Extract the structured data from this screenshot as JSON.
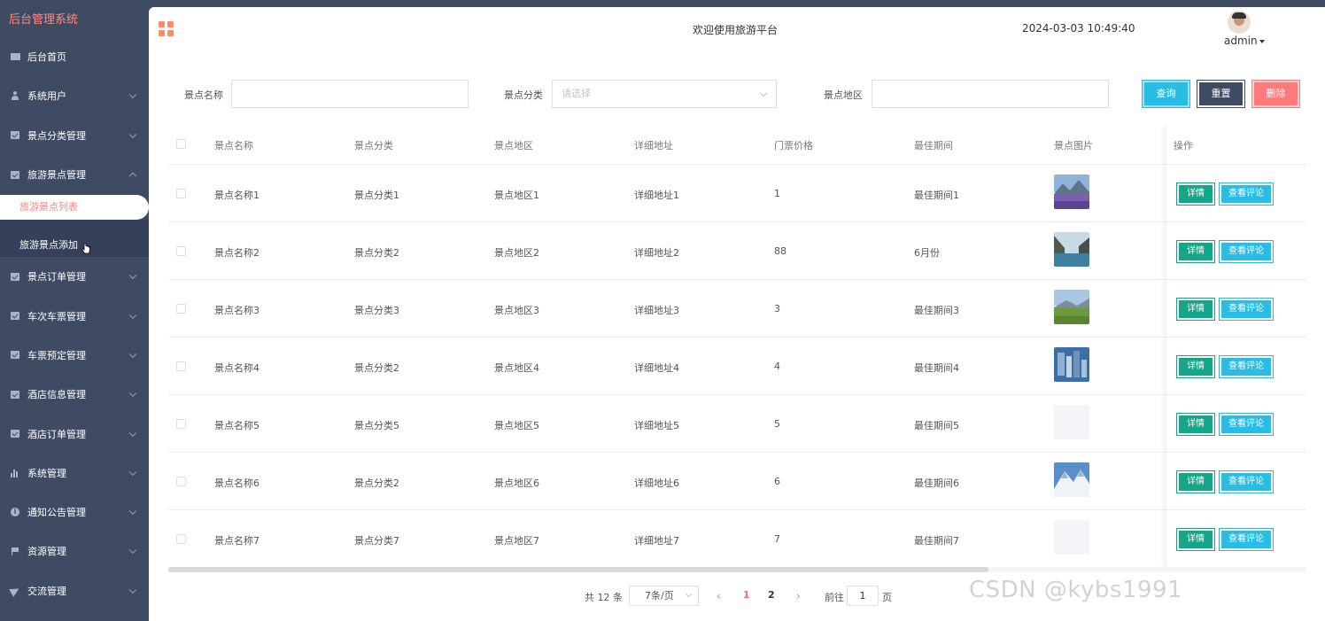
{
  "brand": "后台管理系统",
  "sidebar": {
    "items": [
      {
        "label": "后台首页",
        "icon": "monitor-icon",
        "chevron": false
      },
      {
        "label": "系统用户",
        "icon": "user-icon",
        "chevron": true
      },
      {
        "label": "景点分类管理",
        "icon": "checkbox-icon",
        "chevron": true
      },
      {
        "label": "旅游景点管理",
        "icon": "checkbox-icon",
        "chevron": true,
        "expanded": true
      },
      {
        "label": "景点订单管理",
        "icon": "checkbox-icon",
        "chevron": true
      },
      {
        "label": "车次车票管理",
        "icon": "checkbox-icon",
        "chevron": true
      },
      {
        "label": "车票预定管理",
        "icon": "checkbox-icon",
        "chevron": true
      },
      {
        "label": "酒店信息管理",
        "icon": "checkbox-icon",
        "chevron": true
      },
      {
        "label": "酒店订单管理",
        "icon": "checkbox-icon",
        "chevron": true
      },
      {
        "label": "系统管理",
        "icon": "bar-chart-icon",
        "chevron": true
      },
      {
        "label": "通知公告管理",
        "icon": "info-icon",
        "chevron": true
      },
      {
        "label": "资源管理",
        "icon": "flag-icon",
        "chevron": true
      },
      {
        "label": "交流管理",
        "icon": "send-icon",
        "chevron": true
      }
    ],
    "submenu": {
      "active": "旅游景点列表",
      "other": "旅游景点添加"
    }
  },
  "header": {
    "welcome": "欢迎使用旅游平台",
    "datetime": "2024-03-03 10:49:40",
    "user": "admin"
  },
  "search": {
    "name_label": "景点名称",
    "name_value": "",
    "category_label": "景点分类",
    "category_placeholder": "请选择",
    "region_label": "景点地区",
    "region_value": "",
    "query_btn": "查询",
    "reset_btn": "重置",
    "delete_btn": "删除"
  },
  "table": {
    "columns": [
      "景点名称",
      "景点分类",
      "景点地区",
      "详细地址",
      "门票价格",
      "最佳期间",
      "景点图片",
      "操作"
    ],
    "detail_btn": "详情",
    "comment_btn": "查看评论",
    "rows": [
      {
        "name": "景点名称1",
        "category": "景点分类1",
        "region": "景点地区1",
        "address": "详细地址1",
        "price": "1",
        "period": "最佳期间1",
        "image": "lavender-mountain"
      },
      {
        "name": "景点名称2",
        "category": "景点分类2",
        "region": "景点地区2",
        "address": "详细地址2",
        "price": "88",
        "period": "6月份",
        "image": "lake-valley"
      },
      {
        "name": "景点名称3",
        "category": "景点分类3",
        "region": "景点地区3",
        "address": "详细地址3",
        "price": "3",
        "period": "最佳期间3",
        "image": "grassland"
      },
      {
        "name": "景点名称4",
        "category": "景点分类2",
        "region": "景点地区4",
        "address": "详细地址4",
        "price": "4",
        "period": "最佳期间4",
        "image": "city-aerial"
      },
      {
        "name": "景点名称5",
        "category": "景点分类5",
        "region": "景点地区5",
        "address": "详细地址5",
        "price": "5",
        "period": "最佳期间5",
        "image": "empty"
      },
      {
        "name": "景点名称6",
        "category": "景点分类2",
        "region": "景点地区6",
        "address": "详细地址6",
        "price": "6",
        "period": "最佳期间6",
        "image": "snow-mountain"
      },
      {
        "name": "景点名称7",
        "category": "景点分类7",
        "region": "景点地区7",
        "address": "详细地址7",
        "price": "7",
        "period": "最佳期间7",
        "image": "empty"
      }
    ]
  },
  "pagination": {
    "total": "共 12 条",
    "page_size": "7条/页",
    "pages": [
      "1",
      "2"
    ],
    "current": "1",
    "goto_label": "前往",
    "goto_value": "1",
    "page_suffix": "页"
  },
  "watermark": "CSDN @kybs1991",
  "colors": {
    "sidebar_bg": "#3f4b63",
    "accent": "#ff8a80",
    "query": "#2bbce6",
    "reset": "#3f4b63",
    "delete": "#ff7a7a",
    "detail": "#13a688"
  }
}
